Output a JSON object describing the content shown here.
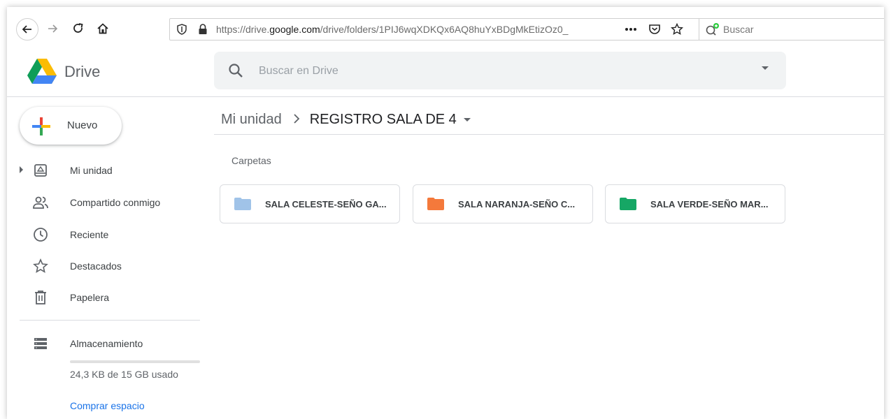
{
  "browser": {
    "url_prefix": "https://drive.",
    "url_domain": "google.com",
    "url_path": "/drive/folders/1PIJ6wqXDKQx6AQ8huYxBDgMkEtizOz0_",
    "search_placeholder": "Buscar"
  },
  "header": {
    "app_name": "Drive",
    "search_placeholder": "Buscar en Drive"
  },
  "sidebar": {
    "new_label": "Nuevo",
    "items": [
      {
        "label": "Mi unidad",
        "icon": "my-drive-icon"
      },
      {
        "label": "Compartido conmigo",
        "icon": "shared-icon"
      },
      {
        "label": "Reciente",
        "icon": "clock-icon"
      },
      {
        "label": "Destacados",
        "icon": "star-icon"
      },
      {
        "label": "Papelera",
        "icon": "trash-icon"
      }
    ],
    "storage": {
      "label": "Almacenamiento",
      "usage_text": "24,3 KB de 15 GB usado",
      "used_fraction": 2e-06,
      "buy_label": "Comprar espacio"
    }
  },
  "main": {
    "breadcrumb": {
      "root": "Mi unidad",
      "current": "REGISTRO SALA DE 4"
    },
    "section_label": "Carpetas",
    "folders": [
      {
        "name": "SALA CELESTE-SEÑO GA...",
        "color": "#a0c3e8"
      },
      {
        "name": "SALA NARANJA-SEÑO C...",
        "color": "#f4793b"
      },
      {
        "name": "SALA VERDE-SEÑO MAR...",
        "color": "#16a765"
      }
    ]
  },
  "colors": {
    "accent": "#1a73e8",
    "divider": "#dadce0"
  }
}
